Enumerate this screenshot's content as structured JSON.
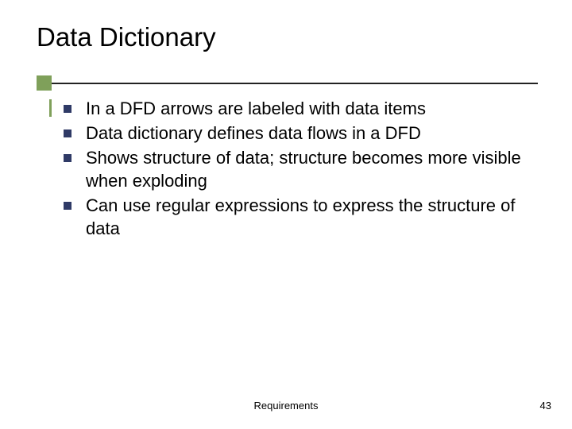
{
  "title": "Data Dictionary",
  "bullets": [
    "In a DFD arrows are labeled with data items",
    "Data dictionary defines data flows in a DFD",
    "Shows structure of data; structure becomes more visible when exploding",
    "Can use regular expressions to express the structure of data"
  ],
  "footer": {
    "center": "Requirements",
    "pageNumber": "43"
  }
}
